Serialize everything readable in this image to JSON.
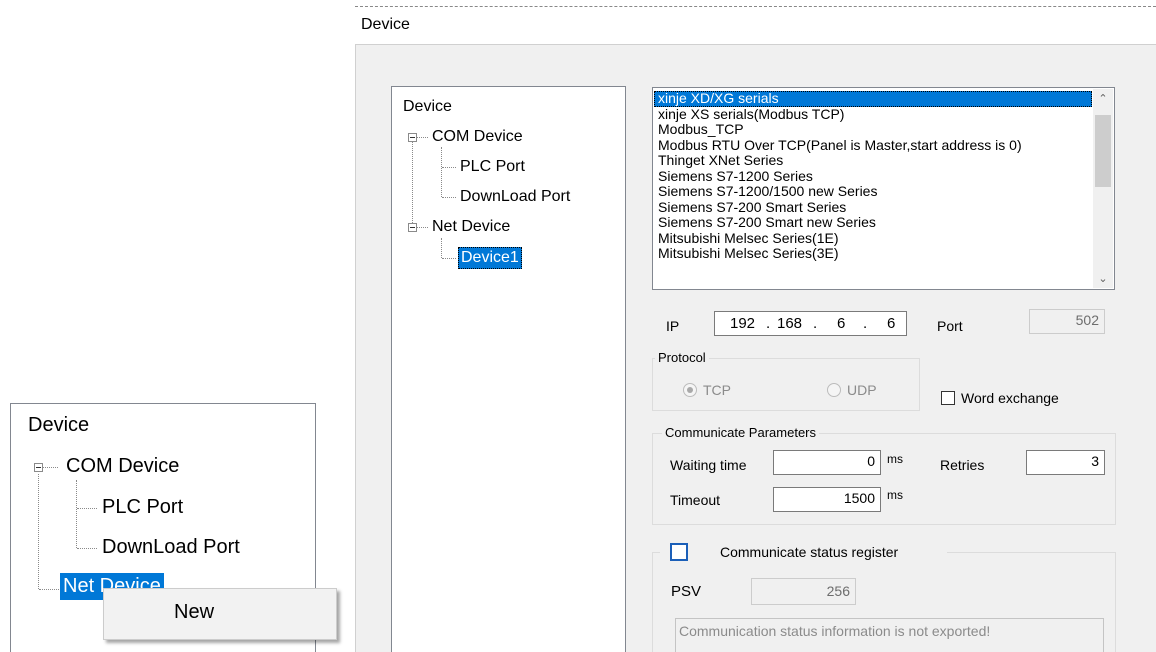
{
  "left_tree": {
    "root": "Device",
    "com_device": "COM Device",
    "plc_port": "PLC Port",
    "download_port": "DownLoad Port",
    "net_device": "Net Device",
    "context_menu": {
      "new": "New"
    }
  },
  "dialog": {
    "title": "Device",
    "tree": {
      "root": "Device",
      "com_device": "COM Device",
      "plc_port": "PLC Port",
      "download_port": "DownLoad Port",
      "net_device": "Net Device",
      "device1": "Device1"
    },
    "protocol_list": [
      "xinje XD/XG serials",
      "xinje XS serials(Modbus TCP)",
      "Modbus_TCP",
      "Modbus RTU Over TCP(Panel is Master,start address is 0)",
      "Thinget XNet Series",
      "Siemens S7-1200 Series",
      "Siemens S7-1200/1500 new Series",
      "Siemens S7-200 Smart Series",
      "Siemens S7-200 Smart new Series",
      "Mitsubishi Melsec Series(1E)",
      "Mitsubishi Melsec Series(3E)"
    ],
    "selected_index": 0,
    "ip_label": "IP",
    "ip": [
      "192",
      "168",
      "6",
      "6"
    ],
    "ip_dot": ".",
    "port_label": "Port",
    "port_value": "502",
    "protocol_group": "Protocol",
    "tcp_label": "TCP",
    "udp_label": "UDP",
    "word_exchange_label": "Word exchange",
    "comm_params_group": "Communicate Parameters",
    "waiting_time_label": "Waiting time",
    "waiting_time_value": "0",
    "timeout_label": "Timeout",
    "timeout_value": "1500",
    "ms_unit": "ms",
    "retries_label": "Retries",
    "retries_value": "3",
    "status_register_label": "Communicate status register",
    "psv_label": "PSV",
    "psv_value": "256",
    "status_info_text": "Communication status information is not exported!"
  },
  "colors": {
    "selection": "#0078d7",
    "dialog_bg": "#f0f0f0",
    "checkbox_border": "#1b5fb8"
  }
}
